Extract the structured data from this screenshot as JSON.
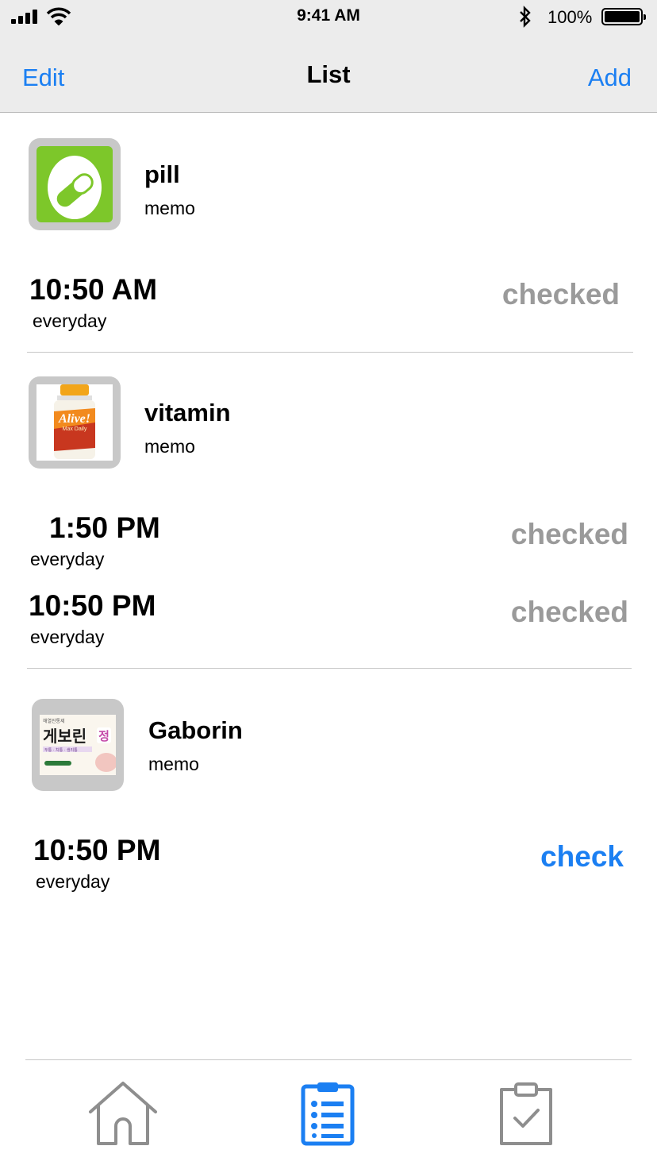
{
  "status_bar": {
    "time": "9:41 AM",
    "battery": "100%",
    "signal_icon": "signal-icon",
    "wifi_icon": "wifi-icon",
    "bluetooth_icon": "bluetooth-icon"
  },
  "nav": {
    "edit_label": "Edit",
    "title": "List",
    "add_label": "Add",
    "accent": "#1b7ff2"
  },
  "items": [
    {
      "name": "pill",
      "memo": "memo",
      "icon": "pill-icon",
      "schedules": [
        {
          "time": "10:50 AM",
          "frequency": "everyday",
          "status": "checked"
        }
      ]
    },
    {
      "name": "vitamin",
      "memo": "memo",
      "icon": "vitamin-bottle-image",
      "image_text": {
        "brand": "Alive!",
        "sub": "Max Daily"
      },
      "schedules": [
        {
          "time": "1:50 PM",
          "frequency": "everyday",
          "status": "checked"
        },
        {
          "time": "10:50 PM",
          "frequency": "everyday",
          "status": "checked"
        }
      ]
    },
    {
      "name": "Gaborin",
      "memo": "memo",
      "icon": "gaborin-box-image",
      "image_text": {
        "brand": "게보린",
        "suffix": "정",
        "top": "해열진통제",
        "sub": "두통 · 치통 · 생리통"
      },
      "schedules": [
        {
          "time": "10:50 PM",
          "frequency": "everyday",
          "status": "check"
        }
      ]
    }
  ],
  "tabbar": {
    "tabs": [
      "home-icon",
      "list-icon",
      "clipboard-check-icon"
    ],
    "active": "list-icon",
    "inactive_color": "#8e8e8e"
  }
}
